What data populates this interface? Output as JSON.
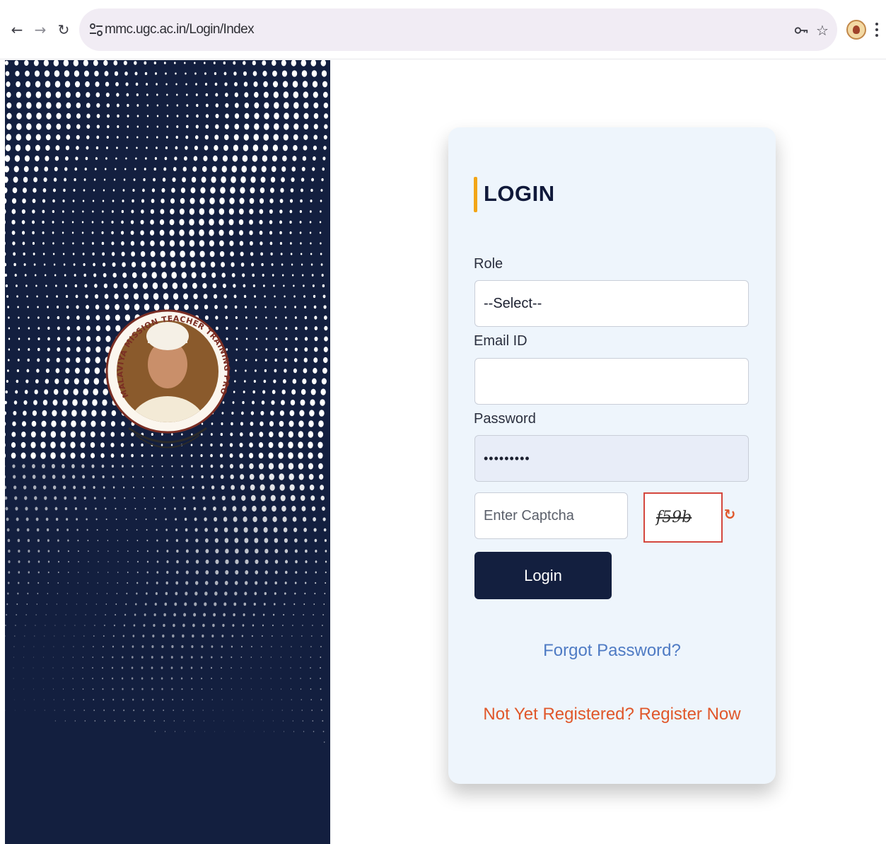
{
  "browser": {
    "url": "mmc.ugc.ac.in/Login/Index",
    "icons": [
      "back-icon",
      "forward-icon",
      "reload-icon",
      "site-info-icon",
      "password-key-icon",
      "bookmark-star-icon",
      "profile-avatar",
      "menu-icon"
    ]
  },
  "left_panel": {
    "logo_text": "MALAVIYA MISSION TEACHER TRAINING PROGRAMME",
    "background_color": "#131f3f"
  },
  "login": {
    "title": "LOGIN",
    "role_label": "Role",
    "role_value": "--Select--",
    "email_label": "Email ID",
    "email_value": "",
    "password_label": "Password",
    "password_value": "•••••••••",
    "captcha_placeholder": "Enter Captcha",
    "captcha_text": "f59b",
    "login_button": "Login",
    "forgot_password": "Forgot Password?",
    "register": "Not Yet Registered? Register Now"
  },
  "colors": {
    "navy": "#131f3f",
    "accent_orange": "#f2a516",
    "link_blue": "#4f7bc4",
    "register_orange": "#e0572a",
    "card_bg": "#eef5fc"
  }
}
